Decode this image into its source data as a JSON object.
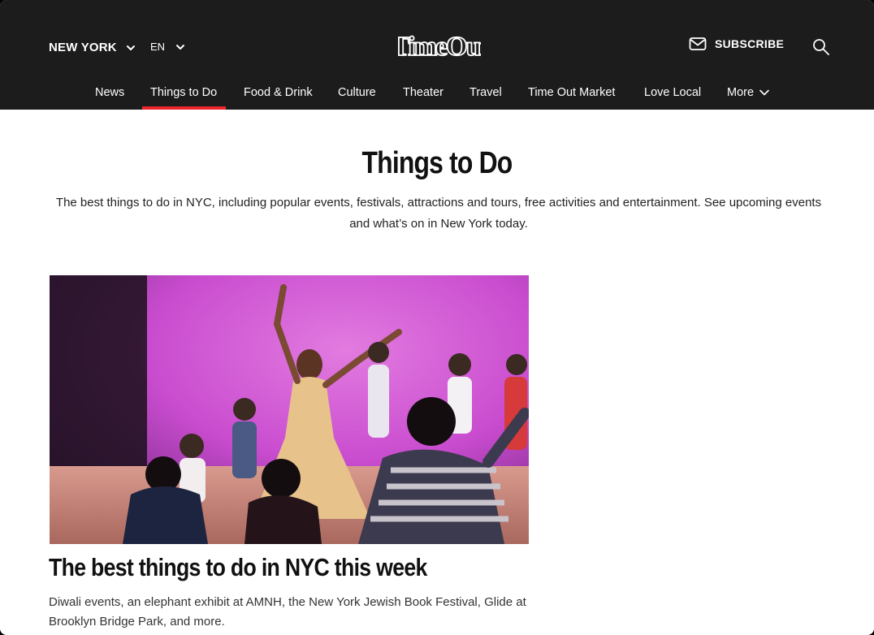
{
  "header": {
    "city": "NEW YORK",
    "language": "EN",
    "logo_text": "TimeOut",
    "subscribe_label": "SUBSCRIBE"
  },
  "nav": {
    "items": [
      {
        "label": "News"
      },
      {
        "label": "Things to Do"
      },
      {
        "label": "Food & Drink"
      },
      {
        "label": "Culture"
      },
      {
        "label": "Theater"
      },
      {
        "label": "Travel"
      },
      {
        "label": "Time Out Market"
      },
      {
        "label": "Love Local"
      },
      {
        "label": "More"
      }
    ],
    "active": "Things to Do"
  },
  "page": {
    "title": "Things to Do",
    "intro": "The best things to do in NYC, including popular events, festivals, attractions and tours, free activities and entertainment. See upcoming events and what’s on in New York today."
  },
  "feature": {
    "title": "The best things to do in NYC this week",
    "description": "Diwali events, an elephant exhibit at AMNH, the New York Jewish Book Festival, Glide at Brooklyn Bridge Park, and more."
  },
  "colors": {
    "header_bg": "#1c1c1c",
    "accent": "#e8262b",
    "stage_light": "#d955d3"
  },
  "icons": [
    "chevron-down-icon",
    "mail-icon",
    "search-icon"
  ]
}
